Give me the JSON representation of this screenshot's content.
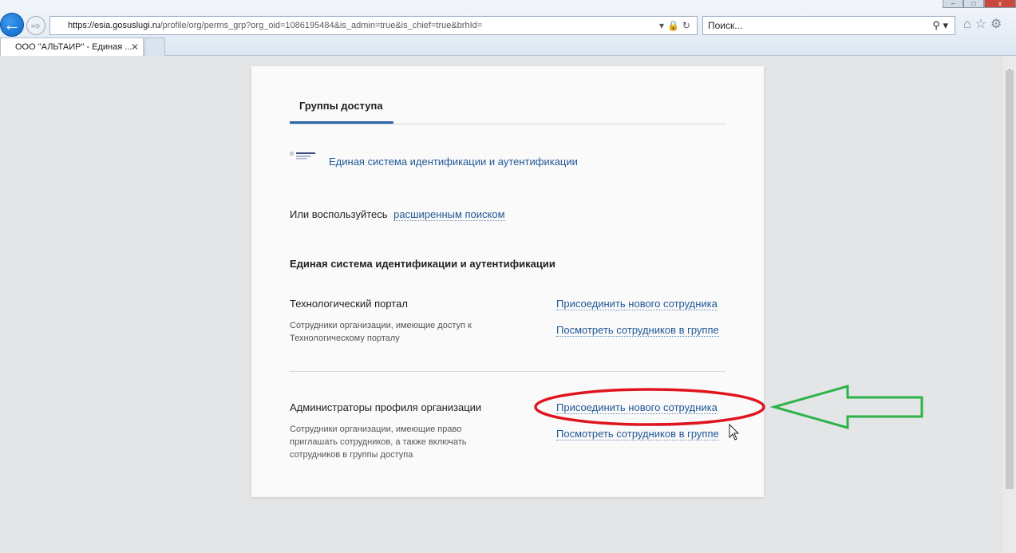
{
  "browser": {
    "url_host": "https://esia.gosuslugi.ru",
    "url_path": "/profile/org/perms_grp?org_oid=1086195484&is_admin=true&is_chief=true&brhId=",
    "search_placeholder": "Поиск...",
    "tab_title": "ООО \"АЛЬТАИР\" - Единая ...",
    "tab_close": "✕",
    "back_glyph": "←",
    "forward_glyph": "⇨",
    "addr_tools": "▾🔒↻",
    "search_glyph": "⚲ ▾",
    "toolbar_glyphs": "⌂☆⚙"
  },
  "page": {
    "tab_heading": "Группы доступа",
    "system_link": "Единая система идентификации и аутентификации",
    "alt_search_prefix": "Или воспользуйтесь",
    "alt_search_link": "расширенным поиском",
    "section_title": "Единая система идентификации и аутентификации",
    "groups": [
      {
        "name": "Технологический портал",
        "description": "Сотрудники организации, имеющие доступ к Технологическому порталу",
        "add_label": "Присоединить нового сотрудника",
        "view_label": "Посмотреть сотрудников в группе"
      },
      {
        "name": "Администраторы профиля организации",
        "description": "Сотрудники организации, имеющие право приглашать сотрудников, а также включать сотрудников в группы доступа",
        "add_label": "Присоединить нового сотрудника",
        "view_label": "Посмотреть сотрудников в группе"
      }
    ]
  },
  "annotations": {
    "highlight_color": "#e0141e",
    "arrow_color": "#2db34a"
  },
  "icons": {
    "back": "arrow-left-icon",
    "forward": "arrow-right-icon",
    "home": "home-icon",
    "favorites": "star-icon",
    "tools": "gear-icon",
    "search": "search-icon",
    "lock": "lock-icon",
    "refresh": "refresh-icon"
  }
}
